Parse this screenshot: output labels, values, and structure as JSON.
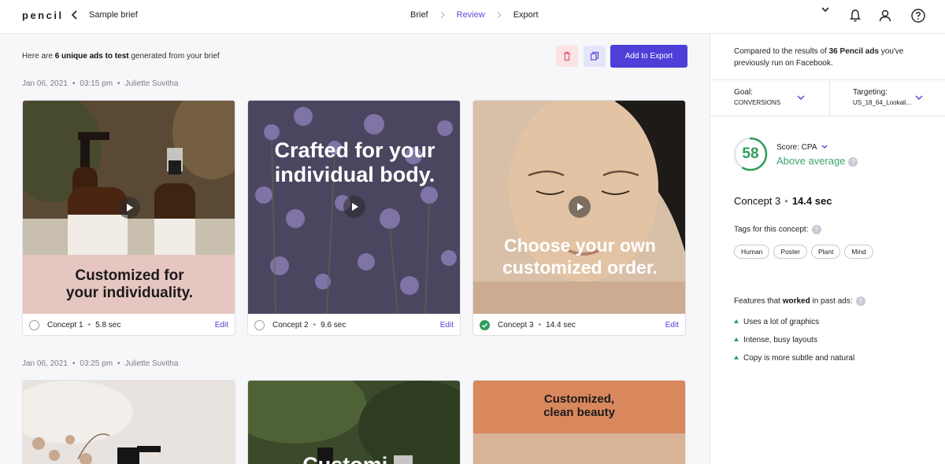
{
  "header": {
    "logo": "pencil",
    "brief_title": "Sample brief",
    "steps": [
      "Brief",
      "Review",
      "Export"
    ],
    "active_step": "Review"
  },
  "main": {
    "intro": {
      "prefix": "Here are ",
      "count_text": "6 unique ads to test",
      "suffix": " generated from your brief"
    },
    "add_to_export_label": "Add to Export",
    "groups": [
      {
        "date": "Jan 06, 2021",
        "time": "03:15 pm",
        "author": "Juliette Suvitha",
        "cards": [
          {
            "overlay": [
              "Customized for",
              "your individuality."
            ],
            "concept": "Concept 1",
            "duration": "5.8 sec",
            "edit": "Edit",
            "selected": false
          },
          {
            "overlay": [
              "Crafted for your",
              "individual body."
            ],
            "concept": "Concept 2",
            "duration": "9.6 sec",
            "edit": "Edit",
            "selected": false
          },
          {
            "overlay": [
              "Choose your own",
              "customized order."
            ],
            "concept": "Concept 3",
            "duration": "14.4 sec",
            "edit": "Edit",
            "selected": true
          }
        ]
      },
      {
        "date": "Jan 06, 2021",
        "time": "03:25 pm",
        "author": "Juliette Suvitha",
        "cards": [
          {
            "overlay": []
          },
          {
            "overlay": [
              "Customi..."
            ]
          },
          {
            "overlay": [
              "Customized,",
              "clean beauty"
            ]
          }
        ]
      }
    ]
  },
  "panel": {
    "compare": {
      "prefix": "Compared to the results of ",
      "bold": "36 Pencil ads",
      "suffix": " you've previously run on Facebook."
    },
    "goal": {
      "label": "Goal:",
      "value": "CONVERSIONS"
    },
    "targeting": {
      "label": "Targeting:",
      "value": "US_18_64_Lookali..."
    },
    "score": {
      "value": "58",
      "label": "Score: CPA",
      "status": "Above average",
      "fraction": 0.58
    },
    "concept_summary": {
      "name": "Concept 3",
      "duration": "14.4 sec"
    },
    "tags_title": "Tags for this concept:",
    "tags": [
      "Human",
      "Poster",
      "Plant",
      "Mind"
    ],
    "features_title": {
      "prefix": "Features that ",
      "bold": "worked",
      "suffix": " in past ads:"
    },
    "features": [
      "Uses a lot of graphics",
      "Intense, busy layouts",
      "Copy is more subtle and natural"
    ]
  },
  "colors": {
    "accent": "#4f3fd8",
    "success": "#2e9e5a",
    "delete_bg": "#fbe3e6"
  }
}
